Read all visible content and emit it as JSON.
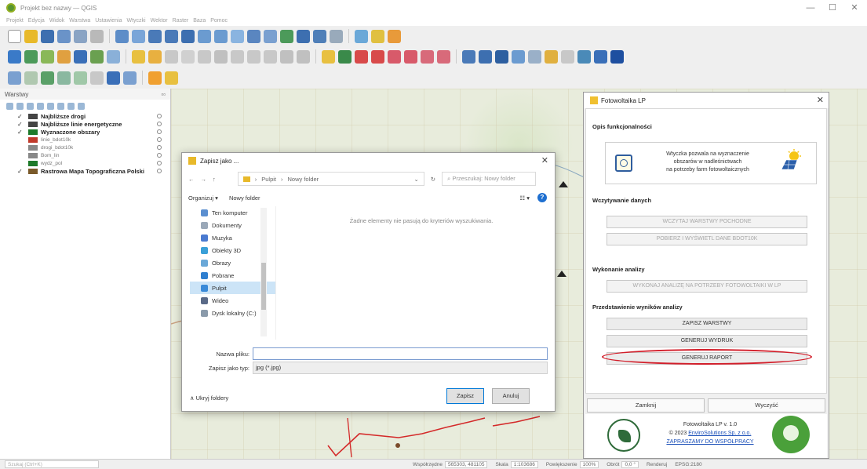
{
  "window": {
    "title": "Projekt bez nazwy — QGIS",
    "controls": [
      "—",
      "☐",
      "✕"
    ]
  },
  "menu": [
    "Projekt",
    "Edycja",
    "Widok",
    "Warstwa",
    "Ustawienia",
    "Wtyczki",
    "Wektor",
    "Raster",
    "Baza",
    "Pomoc"
  ],
  "layers_panel": {
    "title": "Warstwy",
    "layers": [
      {
        "label": "Najbliższe drogi",
        "checked": "✓",
        "color": "#444444",
        "bold": true
      },
      {
        "label": "Najbliższe linie energetyczne",
        "checked": "✓",
        "color": "#444444",
        "bold": true
      },
      {
        "label": "Wyznaczone obszary",
        "checked": "✓",
        "color": "#1e7a2a",
        "bold": true
      },
      {
        "label": "linie_bdot10k",
        "checked": "",
        "color": "#c0392b",
        "bold": false
      },
      {
        "label": "drogi_bdot10k",
        "checked": "",
        "color": "#888888",
        "bold": false
      },
      {
        "label": "Bom_lin",
        "checked": "",
        "color": "#888888",
        "bold": false
      },
      {
        "label": "wydz_pol",
        "checked": "",
        "color": "#1e7a2a",
        "bold": false
      },
      {
        "label": "Rastrowa Mapa Topograficzna Polski",
        "checked": "✓",
        "color": "#7a5a2a",
        "bold": true
      }
    ]
  },
  "save_dialog": {
    "title": "Zapisz jako ...",
    "path": [
      "Pulpit",
      "Nowy folder"
    ],
    "search_placeholder": "Przeszukaj: Nowy folder",
    "organize": "Organizuj ▾",
    "new_folder": "Nowy folder",
    "empty_message": "Żadne elementy nie pasują do kryteriów wyszukiwania.",
    "tree": [
      {
        "label": "Ten komputer",
        "color": "#5b8fd0"
      },
      {
        "label": "Dokumenty",
        "color": "#9aa8b8"
      },
      {
        "label": "Muzyka",
        "color": "#4a7ad0"
      },
      {
        "label": "Obiekty 3D",
        "color": "#3aa0d8"
      },
      {
        "label": "Obrazy",
        "color": "#6aa8d8"
      },
      {
        "label": "Pobrane",
        "color": "#2f7fd0"
      },
      {
        "label": "Pulpit",
        "color": "#3a8ad8"
      },
      {
        "label": "Wideo",
        "color": "#5a6a88"
      },
      {
        "label": "Dysk lokalny (C:)",
        "color": "#8a9aaa"
      }
    ],
    "filename_label": "Nazwa pliku:",
    "filename_value": "",
    "filetype_label": "Zapisz jako typ:",
    "filetype_value": "jpg (*.jpg)",
    "hide_folders": "Ukryj foldery",
    "save_button": "Zapisz",
    "cancel_button": "Anuluj"
  },
  "plugin": {
    "title": "Fotowoltaika LP",
    "sections": {
      "description": "Opis funkcjonalności",
      "loading": "Wczytywanie danych",
      "analysis": "Wykonanie analizy",
      "results": "Przedstawienie wyników analizy"
    },
    "description_text": [
      "Wtyczka pozwala na wyznaczenie",
      "obszarów w nadleśnictwach",
      "na potrzeby farm fotowoltaicznych"
    ],
    "buttons": {
      "load_layers": "WCZYTAJ WARSTWY POCHODNE",
      "fetch_bdot": "POBIERZ I WYŚWIETL DANE BDOT10K",
      "run_analysis": "WYKONAJ ANALIZĘ NA POTRZEBY FOTOWOLTAIKI W LP",
      "save_layers": "ZAPISZ WARSTWY",
      "generate_print": "GENERUJ WYDRUK",
      "generate_report": "GENERUJ RAPORT",
      "close": "Zamknij",
      "clear": "Wyczyść"
    },
    "footer": {
      "version": "Fotowoltaika LP v. 1.0",
      "copyright": "© 2023",
      "company": "EnviroSolutions Sp. z o.o.",
      "cooperation": "ZAPRASZAMY DO WSPÓŁPRACY"
    },
    "highlight_color": "#d21e2a"
  },
  "status_bar": {
    "search_placeholder": "Szukaj (Ctrl+K)",
    "coord_label": "Współrzędne",
    "coord_value": "565303, 481105",
    "scale_label": "Skala",
    "scale_value": "1:103686",
    "magnifier_label": "Powiększenie",
    "magnifier_value": "100%",
    "rotation_label": "Obrót",
    "rotation_value": "0,0 °",
    "render_label": "Renderuj",
    "crs": "EPSG:2180"
  }
}
